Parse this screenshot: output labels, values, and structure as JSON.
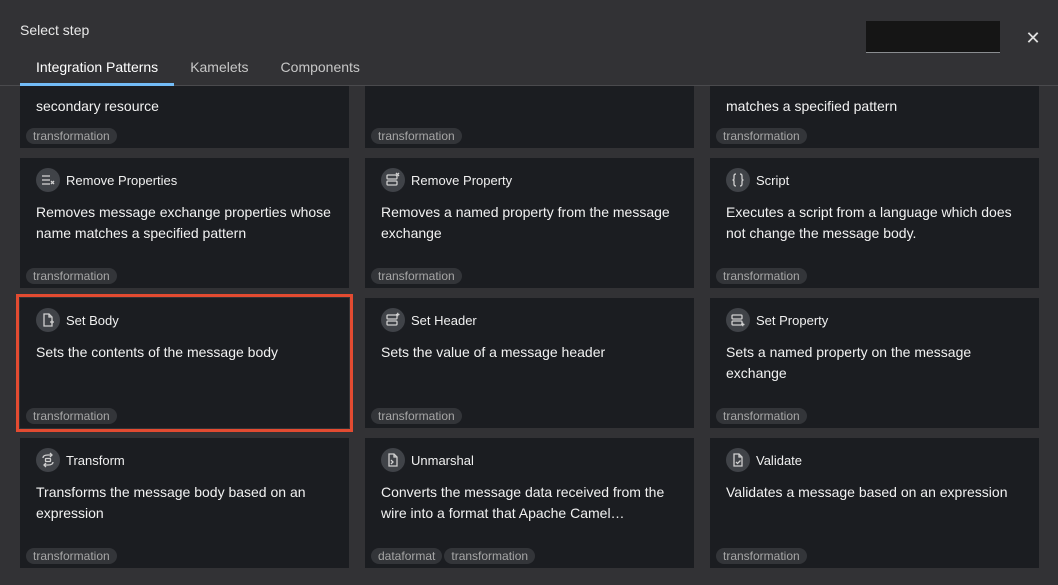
{
  "dialog": {
    "title": "Select step",
    "close_label": "✕",
    "search": {
      "value": "",
      "placeholder": ""
    }
  },
  "tabs": [
    {
      "label": "Integration Patterns",
      "active": true
    },
    {
      "label": "Kamelets",
      "active": false
    },
    {
      "label": "Components",
      "active": false
    }
  ],
  "cards": [
    {
      "title": "",
      "description": "secondary resource",
      "tags": [
        "transformation"
      ],
      "icon": ""
    },
    {
      "title": "",
      "description": "",
      "tags": [
        "transformation"
      ],
      "icon": ""
    },
    {
      "title": "",
      "description": "matches a specified pattern",
      "tags": [
        "transformation"
      ],
      "icon": ""
    },
    {
      "title": "Remove Properties",
      "description": "Removes message exchange properties whose name matches a specified pattern",
      "tags": [
        "transformation"
      ],
      "icon": "remove-properties-icon"
    },
    {
      "title": "Remove Property",
      "description": "Removes a named property from the message exchange",
      "tags": [
        "transformation"
      ],
      "icon": "remove-property-icon"
    },
    {
      "title": "Script",
      "description": "Executes a script from a language which does not change the message body.",
      "tags": [
        "transformation"
      ],
      "icon": "script-icon"
    },
    {
      "title": "Set Body",
      "description": "Sets the contents of the message body",
      "tags": [
        "transformation"
      ],
      "icon": "set-body-icon",
      "selected": true
    },
    {
      "title": "Set Header",
      "description": "Sets the value of a message header",
      "tags": [
        "transformation"
      ],
      "icon": "set-header-icon"
    },
    {
      "title": "Set Property",
      "description": "Sets a named property on the message exchange",
      "tags": [
        "transformation"
      ],
      "icon": "set-property-icon"
    },
    {
      "title": "Transform",
      "description": "Transforms the message body based on an expression",
      "tags": [
        "transformation"
      ],
      "icon": "transform-icon"
    },
    {
      "title": "Unmarshal",
      "description": "Converts the message data received from the wire into a format that Apache Camel…",
      "tags": [
        "dataformat",
        "transformation"
      ],
      "icon": "unmarshal-icon"
    },
    {
      "title": "Validate",
      "description": "Validates a message based on an expression",
      "tags": [
        "transformation"
      ],
      "icon": "validate-icon"
    }
  ],
  "colors": {
    "selection_outline": "#e34b31",
    "active_tab_underline": "#73bcf7",
    "card_background": "#1b1d21",
    "dialog_background": "#323235"
  }
}
